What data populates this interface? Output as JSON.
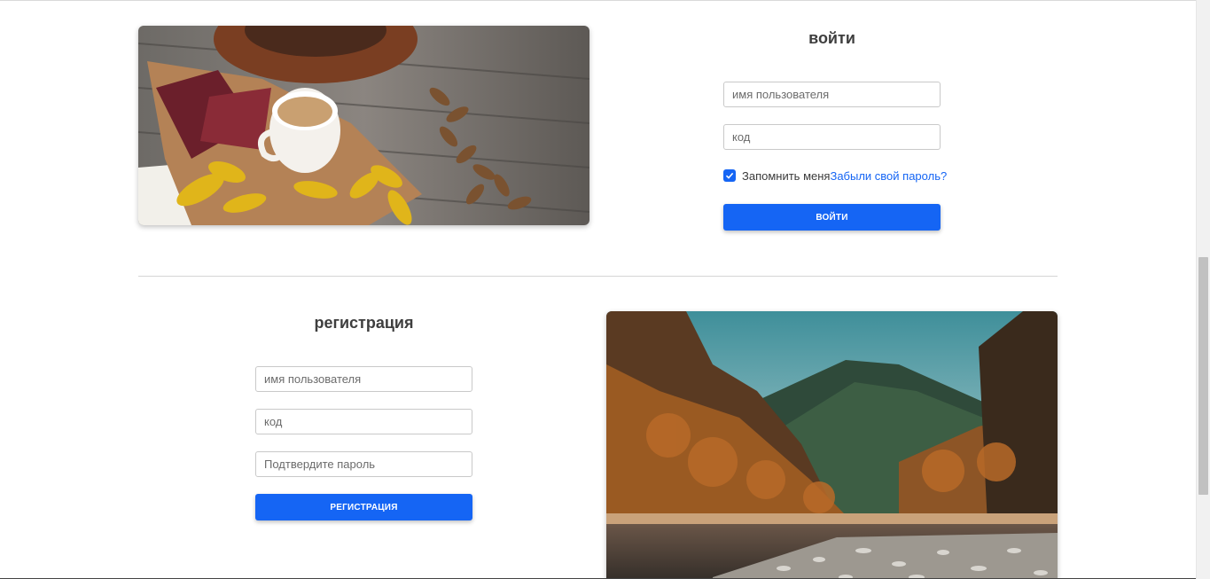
{
  "login": {
    "title": "войти",
    "username_placeholder": "имя пользователя",
    "password_placeholder": "код",
    "remember_label": "Запомнить меня",
    "remember_checked": true,
    "forgot_label": "Забыли свой пароль?",
    "submit_label": "войти"
  },
  "register": {
    "title": "регистрация",
    "username_placeholder": "имя пользователя",
    "password_placeholder": "код",
    "confirm_placeholder": "Подтвердите пароль",
    "submit_label": "регистрация"
  },
  "images": {
    "top": "coffee-autumn-leaves-photo",
    "bottom": "autumn-mountain-river-photo"
  },
  "colors": {
    "accent": "#1565f4",
    "text": "#3a3a3a"
  }
}
